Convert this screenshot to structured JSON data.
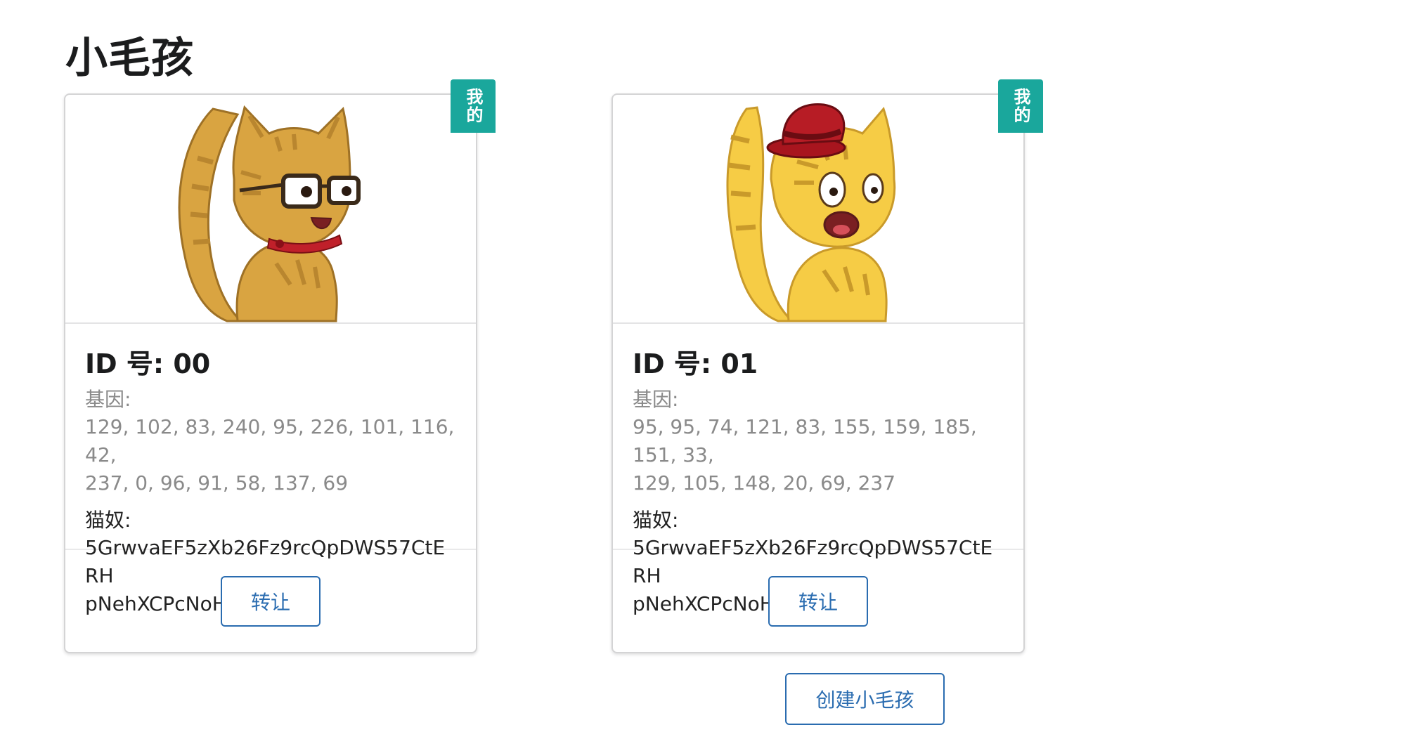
{
  "page_title": "小毛孩",
  "cats": [
    {
      "badge": "我的",
      "id_label": "ID 号: 00",
      "genes_label": "基因:",
      "genes_line1": "129, 102, 83, 240, 95, 226, 101, 116, 42,",
      "genes_line2": "237, 0, 96, 91, 58, 137, 69",
      "owner_label": "猫奴:",
      "owner_line1": "5GrwvaEF5zXb26Fz9rcQpDWS57CtERH",
      "owner_line2": "pNehXCPcNoHGKutQY",
      "transfer_label": "转让",
      "colors": {
        "body": "#d9a441",
        "stripe": "#b9862f",
        "accent": "#c0202a"
      }
    },
    {
      "badge": "我的",
      "id_label": "ID 号: 01",
      "genes_label": "基因:",
      "genes_line1": "95, 95, 74, 121, 83, 155, 159, 185, 151, 33,",
      "genes_line2": "129, 105, 148, 20, 69, 237",
      "owner_label": "猫奴:",
      "owner_line1": "5GrwvaEF5zXb26Fz9rcQpDWS57CtERH",
      "owner_line2": "pNehXCPcNoHGKutQY",
      "transfer_label": "转让",
      "colors": {
        "body": "#f6cc45",
        "stripe": "#c99a2a",
        "accent": "#a8151e"
      }
    }
  ],
  "create_label": "创建小毛孩",
  "theme": {
    "badge": "#1aa79c",
    "button": "#2a6cb0"
  }
}
